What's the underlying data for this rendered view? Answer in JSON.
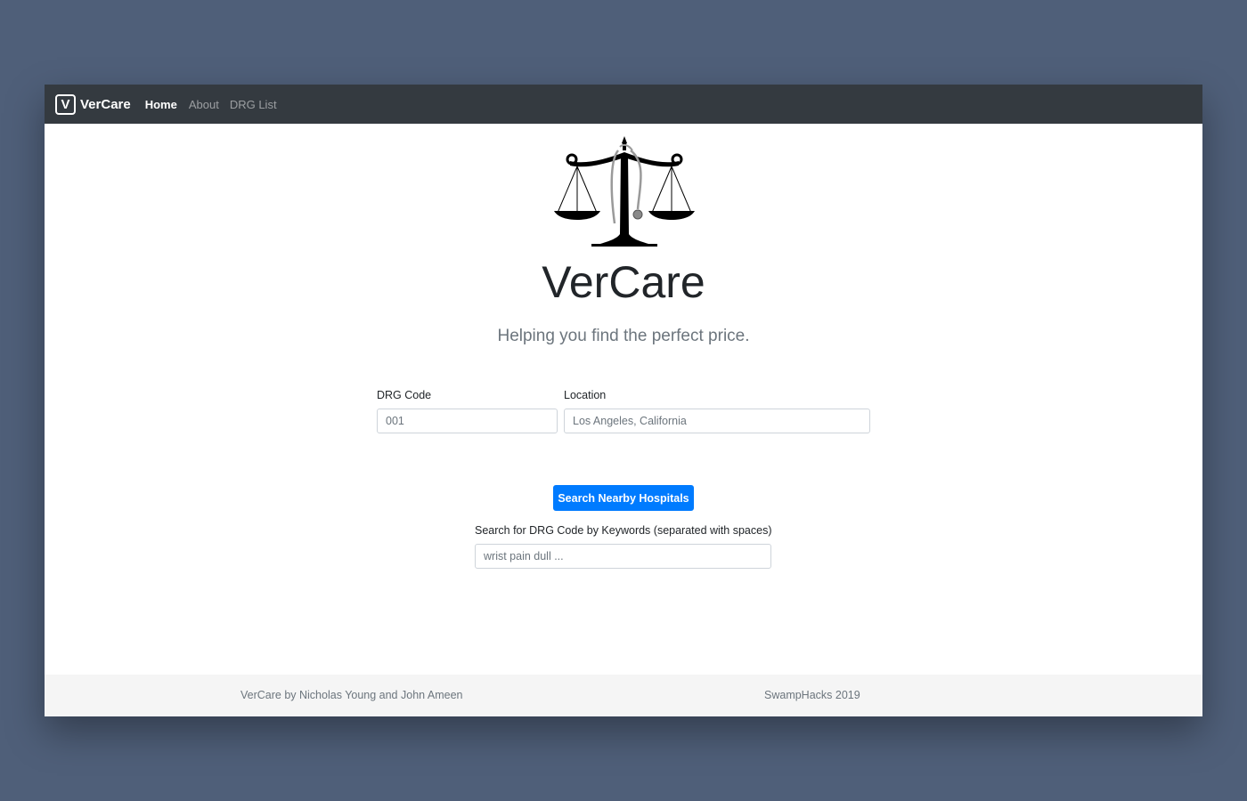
{
  "navbar": {
    "brand_letter": "V",
    "brand_name": "VerCare",
    "links": [
      {
        "label": "Home",
        "active": true
      },
      {
        "label": "About",
        "active": false
      },
      {
        "label": "DRG List",
        "active": false
      }
    ]
  },
  "hero": {
    "logo_icon": "scales-of-justice-icon",
    "title": "VerCare",
    "subtitle": "Helping you find the perfect price."
  },
  "search_form": {
    "drg_code_label": "DRG Code",
    "drg_code_placeholder": "001",
    "location_label": "Location",
    "location_placeholder": "Los Angeles, California",
    "submit_label": "Search Nearby Hospitals"
  },
  "keyword_search": {
    "label": "Search for DRG Code by Keywords (separated with spaces)",
    "placeholder": "wrist pain dull ..."
  },
  "footer": {
    "credits": "VerCare by Nicholas Young and John Ameen",
    "event": "SwampHacks 2019"
  },
  "colors": {
    "navbar_bg": "#343a40",
    "primary": "#007bff",
    "page_bg": "#4f5f79",
    "footer_bg": "#f5f5f5"
  }
}
